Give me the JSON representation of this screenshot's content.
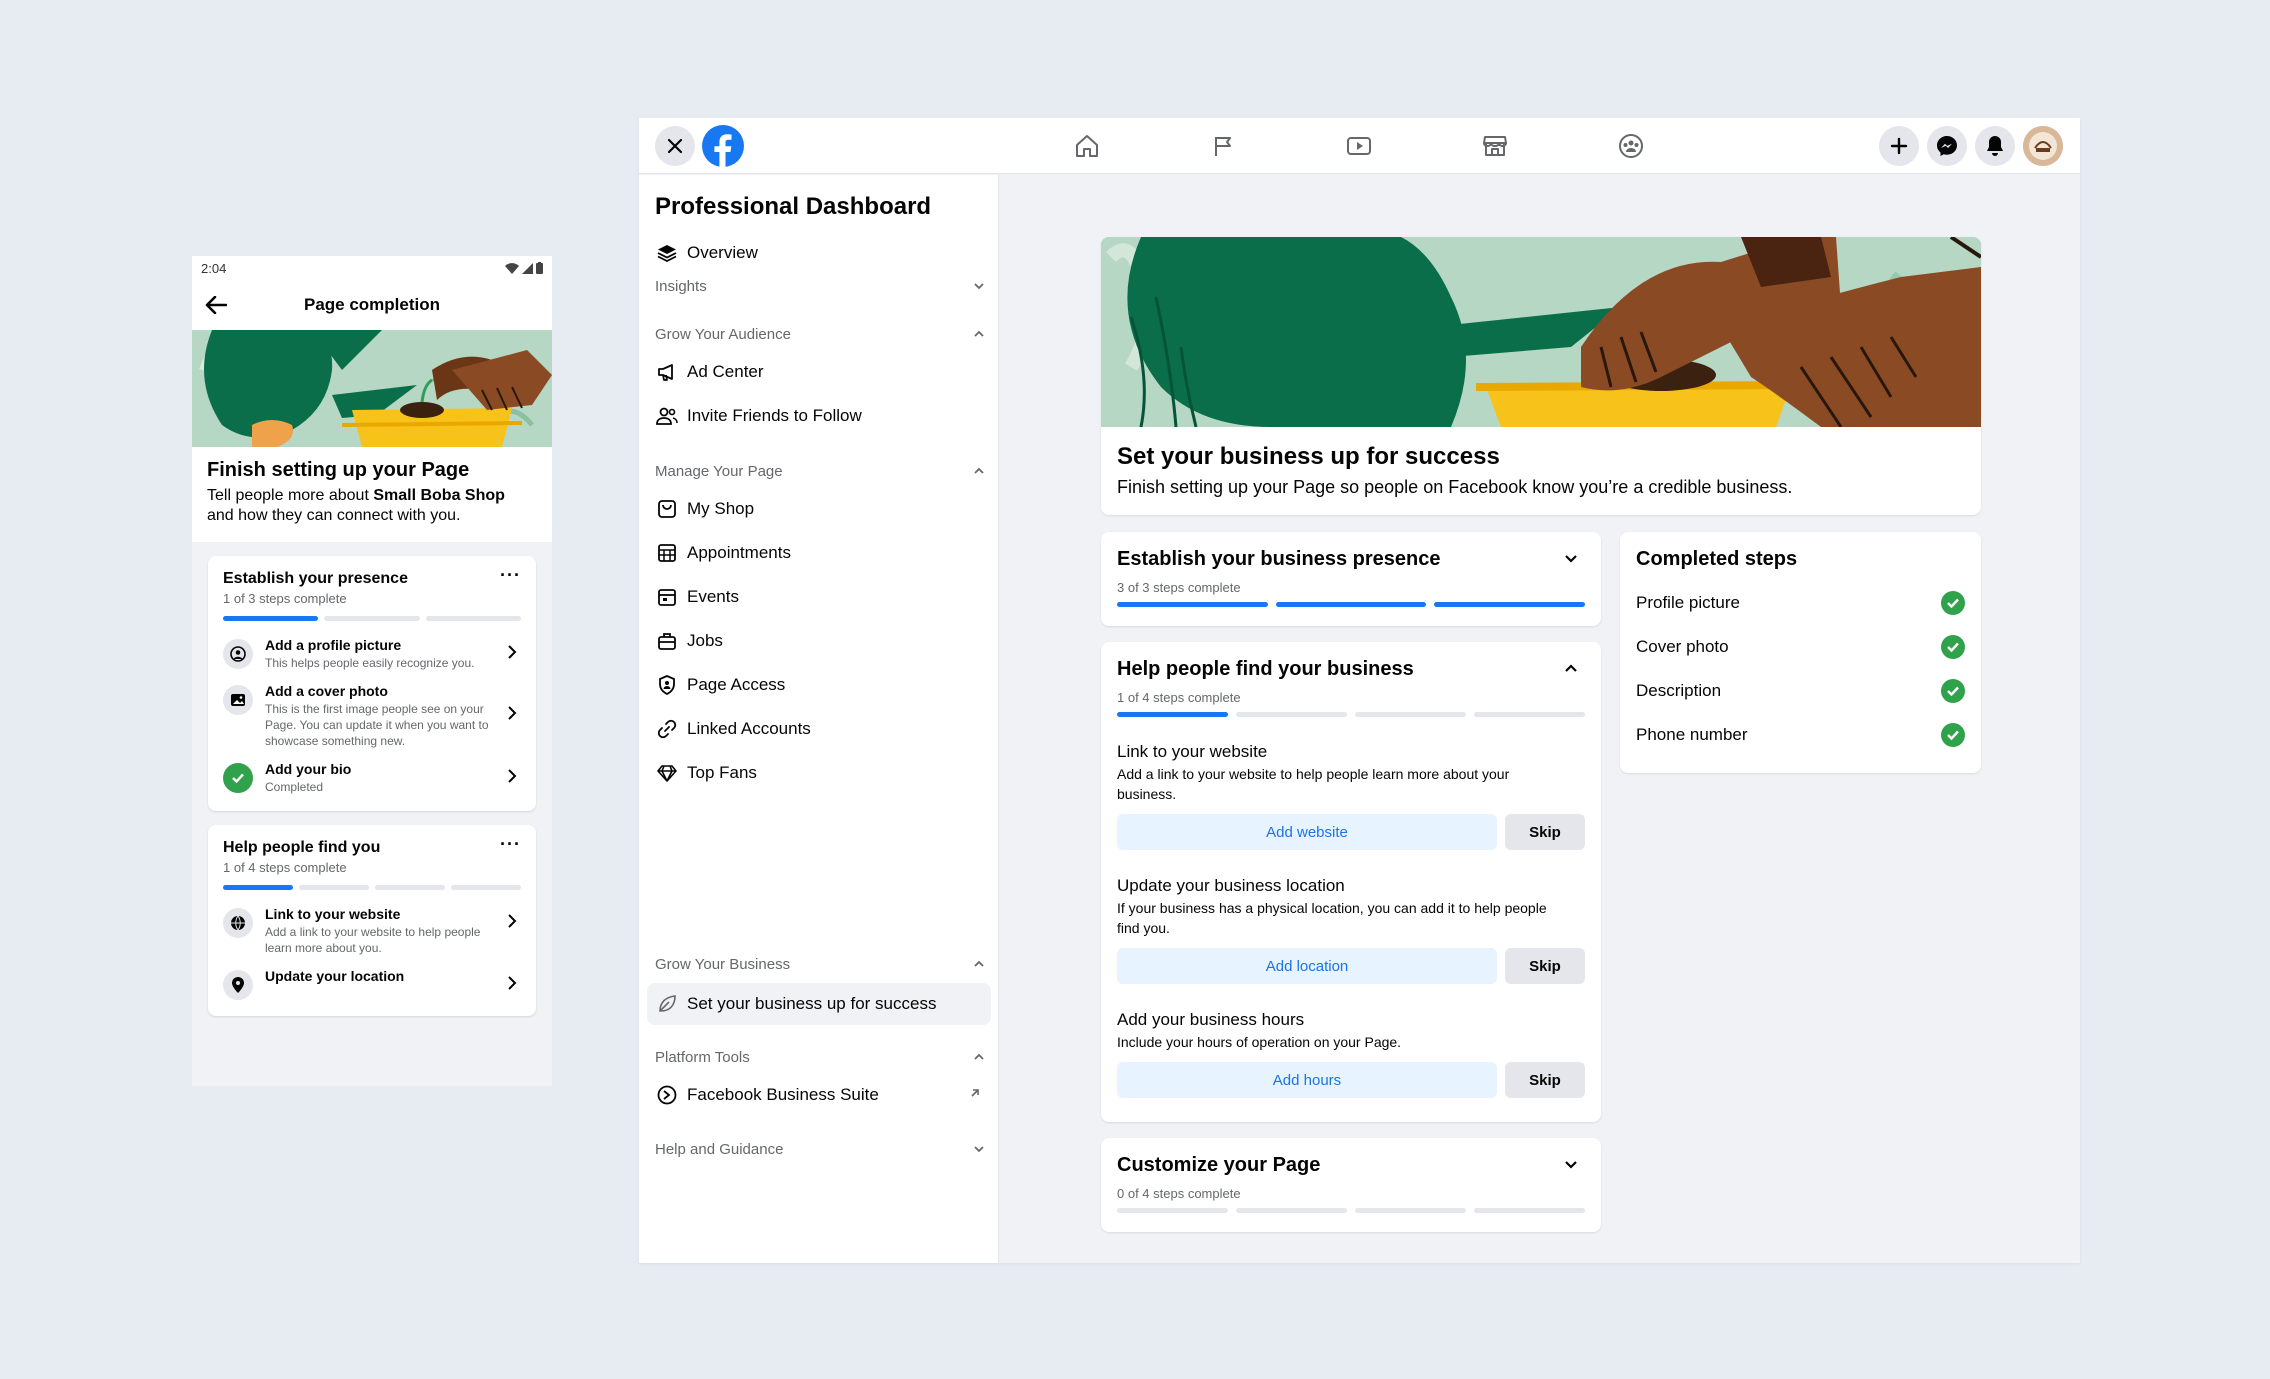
{
  "colors": {
    "accent": "#1877f2",
    "success": "#31a24c",
    "hero_bg": "#b6d7c4",
    "can_green": "#0a6e4a",
    "pot_yellow": "#f7c21a",
    "skin": "#8a4b24"
  },
  "mobile": {
    "status_time": "2:04",
    "header_title": "Page completion",
    "intro_title": "Finish setting up your Page",
    "intro_text_1": "Tell people more about ",
    "intro_shop": "Small Boba Shop",
    "intro_text_2": "and how they can connect with you.",
    "card1": {
      "title": "Establish your presence",
      "sub": "1 of 3 steps complete",
      "progress": [
        1,
        0,
        0
      ],
      "items": [
        {
          "icon": "profile-picture-icon",
          "title": "Add a profile picture",
          "desc": "This helps people easily recognize you."
        },
        {
          "icon": "cover-photo-icon",
          "title": "Add a cover photo",
          "desc": "This is the first image people see on your Page. You can update it when you want to showcase something new."
        },
        {
          "icon": "check-circle-icon",
          "title": "Add your bio",
          "desc": "Completed"
        }
      ]
    },
    "card2": {
      "title": "Help people find you",
      "sub": "1 of 4 steps complete",
      "progress": [
        1,
        0,
        0,
        0
      ],
      "items": [
        {
          "icon": "globe-icon",
          "title": "Link to your website",
          "desc": "Add a link to your website to help people learn more about you."
        },
        {
          "icon": "location-pin-icon",
          "title": "Update your location",
          "desc": ""
        }
      ]
    }
  },
  "desktop": {
    "sidebar": {
      "title": "Professional Dashboard",
      "overview": "Overview",
      "sec_insights": "Insights",
      "sec_grow_audience": "Grow Your Audience",
      "ad_center": "Ad Center",
      "invite_friends": "Invite Friends to Follow",
      "sec_manage": "Manage Your Page",
      "my_shop": "My Shop",
      "appointments": "Appointments",
      "events": "Events",
      "jobs": "Jobs",
      "page_access": "Page Access",
      "linked_accounts": "Linked Accounts",
      "top_fans": "Top Fans",
      "sec_grow_business": "Grow Your Business",
      "set_up_success": "Set your business up for success",
      "sec_platform": "Platform Tools",
      "business_suite": "Facebook Business Suite",
      "sec_help": "Help and Guidance"
    },
    "hero": {
      "title": "Set your business up for success",
      "subtitle": "Finish setting up your Page so people on Facebook know you’re a credible business."
    },
    "presence": {
      "title": "Establish your business presence",
      "sub": "3 of 3 steps complete",
      "progress": [
        1,
        1,
        1
      ]
    },
    "find": {
      "title": "Help people find your business",
      "sub": "1 of 4 steps complete",
      "progress": [
        1,
        0,
        0,
        0
      ],
      "steps": [
        {
          "title": "Link to your website",
          "desc": "Add a link to your website to help people learn more about your business.",
          "action": "Add website",
          "skip": "Skip"
        },
        {
          "title": "Update your business location",
          "desc": "If your business has a physical location, you can add it to help people find you.",
          "action": "Add location",
          "skip": "Skip"
        },
        {
          "title": "Add your business hours",
          "desc": "Include your hours of operation on your Page.",
          "action": "Add hours",
          "skip": "Skip"
        }
      ]
    },
    "customize": {
      "title": "Customize your Page",
      "sub": "0 of 4 steps complete",
      "progress": [
        0,
        0,
        0,
        0
      ]
    },
    "completed": {
      "title": "Completed steps",
      "items": [
        "Profile picture",
        "Cover photo",
        "Description",
        "Phone number"
      ]
    }
  }
}
